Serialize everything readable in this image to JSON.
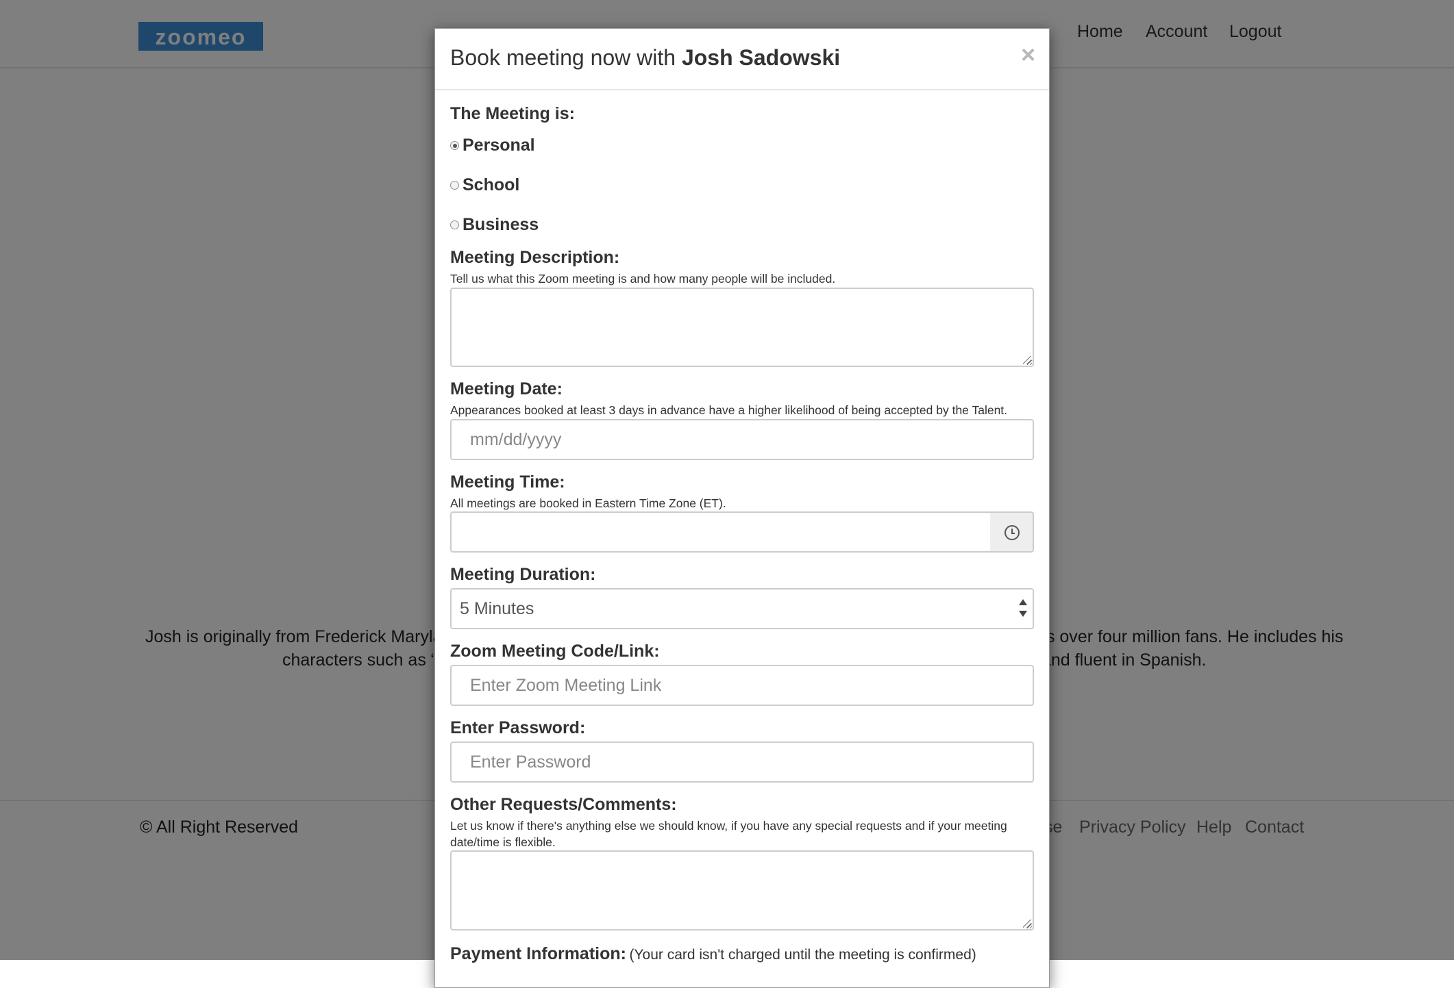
{
  "background": {
    "logo": "zoomeo",
    "nav": [
      "Home",
      "Account",
      "Logout"
    ],
    "bio_line1": "Josh is originally from Frederick Marylan",
    "bio_line1_right": "ts over four million fans. He includes his",
    "bio_line2": "characters such as “I",
    "bio_line2_right": "and fluent in Spanish.",
    "copyright": "© All Right Reserved",
    "footer_links": [
      "se",
      "Privacy Policy",
      "Help",
      "Contact"
    ]
  },
  "modal": {
    "title_prefix": "Book meeting now with",
    "title_name": "Josh Sadowski",
    "close_symbol": "×",
    "meeting_type": {
      "label": "The Meeting is:",
      "options": [
        "Personal",
        "School",
        "Business"
      ],
      "selected": "Personal"
    },
    "description": {
      "label": "Meeting Description:",
      "help": "Tell us what this Zoom meeting is and how many people will be included.",
      "value": ""
    },
    "date": {
      "label": "Meeting Date:",
      "help": "Appearances booked at least 3 days in advance have a higher likelihood of being accepted by the Talent.",
      "placeholder": "mm/dd/yyyy"
    },
    "time": {
      "label": "Meeting Time:",
      "help": "All meetings are booked in Eastern Time Zone (ET).",
      "value": ""
    },
    "duration": {
      "label": "Meeting Duration:",
      "selected": "5 Minutes"
    },
    "zoom_link": {
      "label": "Zoom Meeting Code/Link:",
      "placeholder": "Enter Zoom Meeting Link"
    },
    "password": {
      "label": "Enter Password:",
      "placeholder": "Enter Password"
    },
    "comments": {
      "label": "Other Requests/Comments:",
      "help": "Let us know if there's anything else we should know, if you have any special requests and if your meeting date/time is flexible.",
      "value": ""
    },
    "payment": {
      "label": "Payment Information:",
      "note": "(Your card isn't charged until the meeting is confirmed)"
    }
  }
}
